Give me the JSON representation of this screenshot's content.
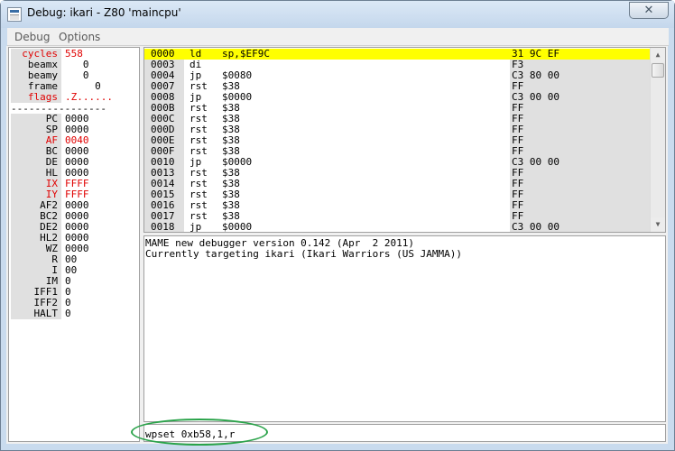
{
  "window": {
    "title": "Debug: ikari - Z80 'maincpu'",
    "close_glyph": "✕"
  },
  "menu": [
    "Debug",
    "Options"
  ],
  "registers": [
    {
      "name": "cycles",
      "value": "558",
      "red": true
    },
    {
      "name": "beamx",
      "value": "   0",
      "red": false
    },
    {
      "name": "beamy",
      "value": "   0",
      "red": false
    },
    {
      "name": "frame",
      "value": "     0",
      "red": false
    },
    {
      "name": "flags",
      "value": ".Z......",
      "red": true
    }
  ],
  "registers_separator": "----------------",
  "cpu_registers": [
    {
      "name": "PC",
      "value": "0000",
      "red": false
    },
    {
      "name": "SP",
      "value": "0000",
      "red": false
    },
    {
      "name": "AF",
      "value": "0040",
      "red": true
    },
    {
      "name": "BC",
      "value": "0000",
      "red": false
    },
    {
      "name": "DE",
      "value": "0000",
      "red": false
    },
    {
      "name": "HL",
      "value": "0000",
      "red": false
    },
    {
      "name": "IX",
      "value": "FFFF",
      "red": true
    },
    {
      "name": "IY",
      "value": "FFFF",
      "red": true
    },
    {
      "name": "AF2",
      "value": "0000",
      "red": false
    },
    {
      "name": "BC2",
      "value": "0000",
      "red": false
    },
    {
      "name": "DE2",
      "value": "0000",
      "red": false
    },
    {
      "name": "HL2",
      "value": "0000",
      "red": false
    },
    {
      "name": "WZ",
      "value": "0000",
      "red": false
    },
    {
      "name": "R",
      "value": "00",
      "red": false
    },
    {
      "name": "I",
      "value": "00",
      "red": false
    },
    {
      "name": "IM",
      "value": "0",
      "red": false
    },
    {
      "name": "IFF1",
      "value": "0",
      "red": false
    },
    {
      "name": "IFF2",
      "value": "0",
      "red": false
    },
    {
      "name": "HALT",
      "value": "0",
      "red": false
    }
  ],
  "disassembly": [
    {
      "addr": "0000",
      "mnemonic": "ld",
      "operand": "sp,$EF9C",
      "bytes": "31 9C EF",
      "current": true
    },
    {
      "addr": "0003",
      "mnemonic": "di",
      "operand": "",
      "bytes": "F3",
      "current": false
    },
    {
      "addr": "0004",
      "mnemonic": "jp",
      "operand": "$0080",
      "bytes": "C3 80 00",
      "current": false
    },
    {
      "addr": "0007",
      "mnemonic": "rst",
      "operand": "$38",
      "bytes": "FF",
      "current": false
    },
    {
      "addr": "0008",
      "mnemonic": "jp",
      "operand": "$0000",
      "bytes": "C3 00 00",
      "current": false
    },
    {
      "addr": "000B",
      "mnemonic": "rst",
      "operand": "$38",
      "bytes": "FF",
      "current": false
    },
    {
      "addr": "000C",
      "mnemonic": "rst",
      "operand": "$38",
      "bytes": "FF",
      "current": false
    },
    {
      "addr": "000D",
      "mnemonic": "rst",
      "operand": "$38",
      "bytes": "FF",
      "current": false
    },
    {
      "addr": "000E",
      "mnemonic": "rst",
      "operand": "$38",
      "bytes": "FF",
      "current": false
    },
    {
      "addr": "000F",
      "mnemonic": "rst",
      "operand": "$38",
      "bytes": "FF",
      "current": false
    },
    {
      "addr": "0010",
      "mnemonic": "jp",
      "operand": "$0000",
      "bytes": "C3 00 00",
      "current": false
    },
    {
      "addr": "0013",
      "mnemonic": "rst",
      "operand": "$38",
      "bytes": "FF",
      "current": false
    },
    {
      "addr": "0014",
      "mnemonic": "rst",
      "operand": "$38",
      "bytes": "FF",
      "current": false
    },
    {
      "addr": "0015",
      "mnemonic": "rst",
      "operand": "$38",
      "bytes": "FF",
      "current": false
    },
    {
      "addr": "0016",
      "mnemonic": "rst",
      "operand": "$38",
      "bytes": "FF",
      "current": false
    },
    {
      "addr": "0017",
      "mnemonic": "rst",
      "operand": "$38",
      "bytes": "FF",
      "current": false
    },
    {
      "addr": "0018",
      "mnemonic": "jp",
      "operand": "$0000",
      "bytes": "C3 00 00",
      "current": false
    }
  ],
  "console": [
    "MAME new debugger version 0.142 (Apr  2 2011)",
    "Currently targeting ikari (Ikari Warriors (US JAMMA))"
  ],
  "command": {
    "value": "wpset 0xb58,1,r"
  },
  "colors": {
    "highlight_row": "#ffff00",
    "register_red": "#e00000",
    "annotation_ellipse": "#2aa34a"
  }
}
